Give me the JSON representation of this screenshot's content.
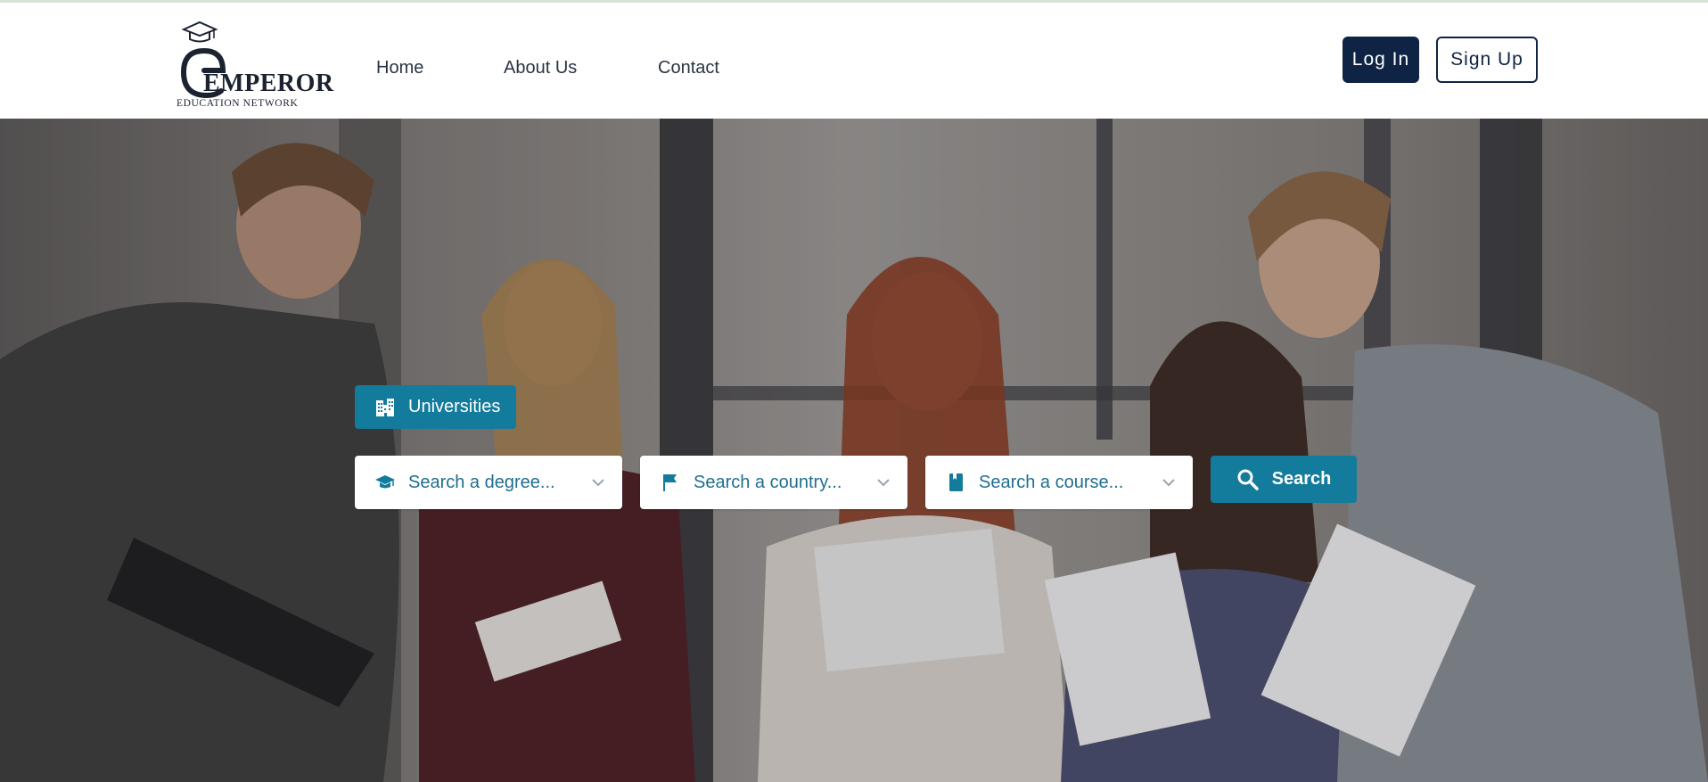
{
  "brand": {
    "name": "EMPEROR",
    "tagline": "EDUCATION NETWORK"
  },
  "nav": {
    "items": [
      {
        "label": "Home"
      },
      {
        "label": "About Us"
      },
      {
        "label": "Contact"
      }
    ]
  },
  "auth": {
    "login_label": "Log In",
    "signup_label": "Sign Up"
  },
  "search": {
    "tab_label": "Universities",
    "tab_icon": "building-icon",
    "degree_placeholder": "Search a degree...",
    "country_placeholder": "Search a country...",
    "course_placeholder": "Search a course...",
    "submit_label": "Search"
  },
  "colors": {
    "navy": "#0f2444",
    "teal": "#137b9b",
    "placeholder": "#1f6f8f"
  }
}
